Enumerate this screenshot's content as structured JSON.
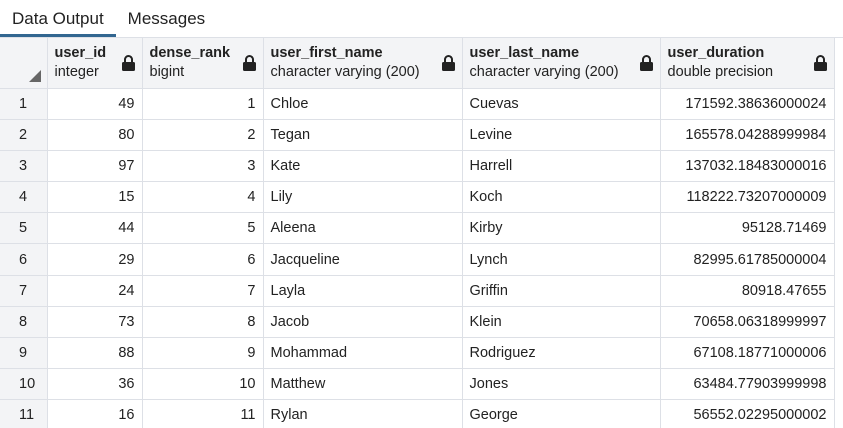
{
  "tabs": [
    {
      "label": "Data Output",
      "active": true
    },
    {
      "label": "Messages",
      "active": false
    }
  ],
  "columns": [
    {
      "name": "user_id",
      "type": "integer"
    },
    {
      "name": "dense_rank",
      "type": "bigint"
    },
    {
      "name": "user_first_name",
      "type": "character varying (200)"
    },
    {
      "name": "user_last_name",
      "type": "character varying (200)"
    },
    {
      "name": "user_duration",
      "type": "double precision"
    }
  ],
  "rows": [
    {
      "n": "1",
      "cells": [
        "49",
        "1",
        "Chloe",
        "Cuevas",
        "171592.38636000024"
      ]
    },
    {
      "n": "2",
      "cells": [
        "80",
        "2",
        "Tegan",
        "Levine",
        "165578.04288999984"
      ]
    },
    {
      "n": "3",
      "cells": [
        "97",
        "3",
        "Kate",
        "Harrell",
        "137032.18483000016"
      ]
    },
    {
      "n": "4",
      "cells": [
        "15",
        "4",
        "Lily",
        "Koch",
        "118222.73207000009"
      ]
    },
    {
      "n": "5",
      "cells": [
        "44",
        "5",
        "Aleena",
        "Kirby",
        "95128.71469"
      ]
    },
    {
      "n": "6",
      "cells": [
        "29",
        "6",
        "Jacqueline",
        "Lynch",
        "82995.61785000004"
      ]
    },
    {
      "n": "7",
      "cells": [
        "24",
        "7",
        "Layla",
        "Griffin",
        "80918.47655"
      ]
    },
    {
      "n": "8",
      "cells": [
        "73",
        "8",
        "Jacob",
        "Klein",
        "70658.06318999997"
      ]
    },
    {
      "n": "9",
      "cells": [
        "88",
        "9",
        "Mohammad",
        "Rodriguez",
        "67108.18771000006"
      ]
    },
    {
      "n": "10",
      "cells": [
        "36",
        "10",
        "Matthew",
        "Jones",
        "63484.77903999998"
      ]
    },
    {
      "n": "11",
      "cells": [
        "16",
        "11",
        "Rylan",
        "George",
        "56552.02295000002"
      ]
    }
  ],
  "colors": {
    "accent": "#326690",
    "header_bg": "#f3f4f6",
    "grid_line": "#dde0e6"
  }
}
